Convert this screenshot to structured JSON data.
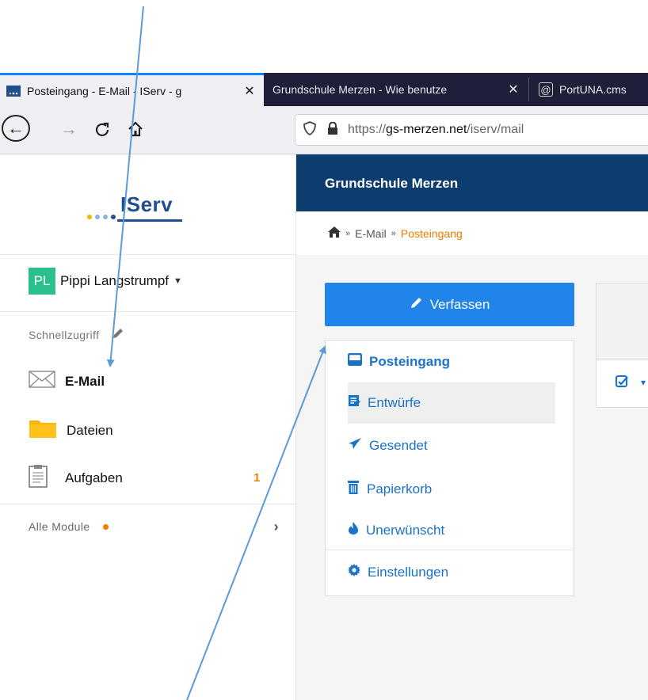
{
  "browser": {
    "tabs": [
      {
        "title": "Posteingang - E-Mail - IServ - g",
        "active": true,
        "favicon": "iserv-favicon-icon"
      },
      {
        "title": "Grundschule Merzen - Wie benutze",
        "active": false
      },
      {
        "title": "PortUNA.cms",
        "active": false,
        "favicon": "at-sign-icon"
      }
    ],
    "url_scheme": "https://",
    "url_host": "gs-merzen.net",
    "url_path": "/iserv/mail"
  },
  "sidebar": {
    "logo_text": "IServ",
    "user": {
      "initials": "PL",
      "name": "Pippi Langstrumpf",
      "avatar_color": "#2bbf8e"
    },
    "quick_access_label": "Schnellzugriff",
    "items": [
      {
        "label": "E-Mail",
        "icon": "envelope-icon",
        "active": true,
        "badge": ""
      },
      {
        "label": "Dateien",
        "icon": "folder-icon",
        "active": false,
        "badge": ""
      },
      {
        "label": "Aufgaben",
        "icon": "clipboard-icon",
        "active": false,
        "badge": "1"
      }
    ],
    "all_modules_label": "Alle Module",
    "badge_color": "#f07c00"
  },
  "header": {
    "school_name": "Grundschule Merzen",
    "color": "#0c3d6e"
  },
  "breadcrumb": {
    "items": [
      "E-Mail",
      "Posteingang"
    ],
    "separator": "»"
  },
  "mail": {
    "compose_label": "Verfassen",
    "compose_color": "#2084e9",
    "folders": [
      {
        "label": "Posteingang",
        "icon": "inbox-icon",
        "active": true
      },
      {
        "label": "Entwürfe",
        "icon": "draft-icon",
        "active": false,
        "hover": true
      },
      {
        "label": "Gesendet",
        "icon": "send-icon",
        "active": false
      },
      {
        "label": "Papierkorb",
        "icon": "trash-icon",
        "active": false
      },
      {
        "label": "Unerwünscht",
        "icon": "fire-icon",
        "active": false
      }
    ],
    "settings_label": "Einstellungen",
    "link_color": "#1a73c8"
  },
  "annotations": {
    "arrow_color": "#5b9bd5"
  }
}
